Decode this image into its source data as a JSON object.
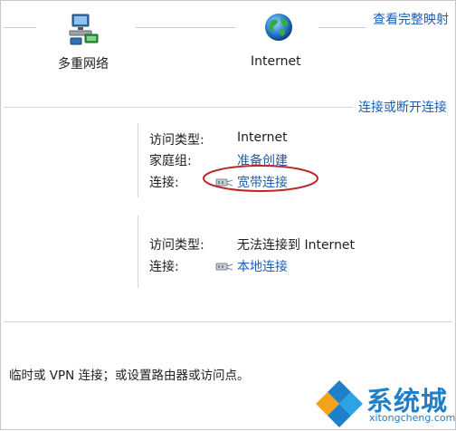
{
  "header": {
    "view_full_map": "查看完整映射"
  },
  "map": {
    "node_left": "多重网络",
    "node_right": "Internet"
  },
  "networks_header": {
    "connect_disconnect": "连接或断开连接"
  },
  "network1": {
    "access_type_label": "访问类型:",
    "access_type_value": "Internet",
    "homegroup_label": "家庭组:",
    "homegroup_value": "准备创建",
    "connections_label": "连接:",
    "connection_name": "宽带连接"
  },
  "network2": {
    "access_type_label": "访问类型:",
    "access_type_value": "无法连接到 Internet",
    "connections_label": "连接:",
    "connection_name": "本地连接"
  },
  "footer": {
    "text": "临时或 VPN 连接；或设置路由器或访问点。"
  },
  "watermark": {
    "brand": "系统城",
    "domain": "xitongcheng.com"
  },
  "colors": {
    "link": "#1a5fb4",
    "highlight_ellipse": "#c0272d",
    "separator": "#d4d4d4",
    "watermark_blue": "#1f7fc8"
  }
}
